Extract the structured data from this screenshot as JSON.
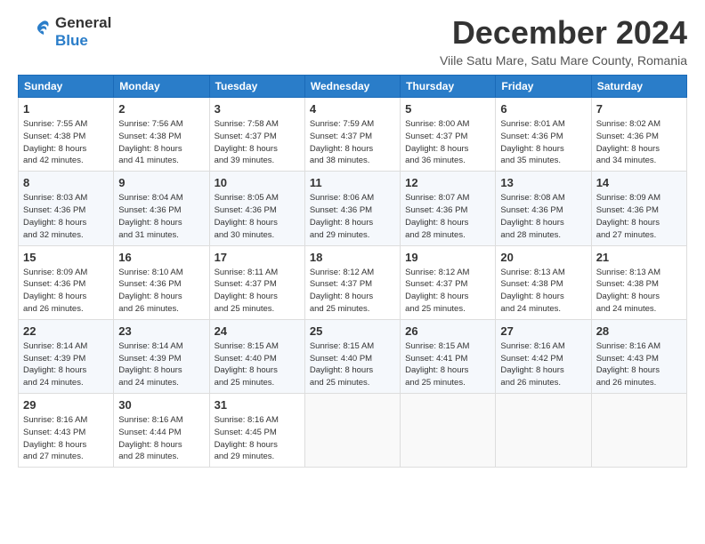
{
  "header": {
    "logo_general": "General",
    "logo_blue": "Blue",
    "month_title": "December 2024",
    "subtitle": "Viile Satu Mare, Satu Mare County, Romania"
  },
  "weekdays": [
    "Sunday",
    "Monday",
    "Tuesday",
    "Wednesday",
    "Thursday",
    "Friday",
    "Saturday"
  ],
  "weeks": [
    [
      {
        "day": "1",
        "info": "Sunrise: 7:55 AM\nSunset: 4:38 PM\nDaylight: 8 hours\nand 42 minutes."
      },
      {
        "day": "2",
        "info": "Sunrise: 7:56 AM\nSunset: 4:38 PM\nDaylight: 8 hours\nand 41 minutes."
      },
      {
        "day": "3",
        "info": "Sunrise: 7:58 AM\nSunset: 4:37 PM\nDaylight: 8 hours\nand 39 minutes."
      },
      {
        "day": "4",
        "info": "Sunrise: 7:59 AM\nSunset: 4:37 PM\nDaylight: 8 hours\nand 38 minutes."
      },
      {
        "day": "5",
        "info": "Sunrise: 8:00 AM\nSunset: 4:37 PM\nDaylight: 8 hours\nand 36 minutes."
      },
      {
        "day": "6",
        "info": "Sunrise: 8:01 AM\nSunset: 4:36 PM\nDaylight: 8 hours\nand 35 minutes."
      },
      {
        "day": "7",
        "info": "Sunrise: 8:02 AM\nSunset: 4:36 PM\nDaylight: 8 hours\nand 34 minutes."
      }
    ],
    [
      {
        "day": "8",
        "info": "Sunrise: 8:03 AM\nSunset: 4:36 PM\nDaylight: 8 hours\nand 32 minutes."
      },
      {
        "day": "9",
        "info": "Sunrise: 8:04 AM\nSunset: 4:36 PM\nDaylight: 8 hours\nand 31 minutes."
      },
      {
        "day": "10",
        "info": "Sunrise: 8:05 AM\nSunset: 4:36 PM\nDaylight: 8 hours\nand 30 minutes."
      },
      {
        "day": "11",
        "info": "Sunrise: 8:06 AM\nSunset: 4:36 PM\nDaylight: 8 hours\nand 29 minutes."
      },
      {
        "day": "12",
        "info": "Sunrise: 8:07 AM\nSunset: 4:36 PM\nDaylight: 8 hours\nand 28 minutes."
      },
      {
        "day": "13",
        "info": "Sunrise: 8:08 AM\nSunset: 4:36 PM\nDaylight: 8 hours\nand 28 minutes."
      },
      {
        "day": "14",
        "info": "Sunrise: 8:09 AM\nSunset: 4:36 PM\nDaylight: 8 hours\nand 27 minutes."
      }
    ],
    [
      {
        "day": "15",
        "info": "Sunrise: 8:09 AM\nSunset: 4:36 PM\nDaylight: 8 hours\nand 26 minutes."
      },
      {
        "day": "16",
        "info": "Sunrise: 8:10 AM\nSunset: 4:36 PM\nDaylight: 8 hours\nand 26 minutes."
      },
      {
        "day": "17",
        "info": "Sunrise: 8:11 AM\nSunset: 4:37 PM\nDaylight: 8 hours\nand 25 minutes."
      },
      {
        "day": "18",
        "info": "Sunrise: 8:12 AM\nSunset: 4:37 PM\nDaylight: 8 hours\nand 25 minutes."
      },
      {
        "day": "19",
        "info": "Sunrise: 8:12 AM\nSunset: 4:37 PM\nDaylight: 8 hours\nand 25 minutes."
      },
      {
        "day": "20",
        "info": "Sunrise: 8:13 AM\nSunset: 4:38 PM\nDaylight: 8 hours\nand 24 minutes."
      },
      {
        "day": "21",
        "info": "Sunrise: 8:13 AM\nSunset: 4:38 PM\nDaylight: 8 hours\nand 24 minutes."
      }
    ],
    [
      {
        "day": "22",
        "info": "Sunrise: 8:14 AM\nSunset: 4:39 PM\nDaylight: 8 hours\nand 24 minutes."
      },
      {
        "day": "23",
        "info": "Sunrise: 8:14 AM\nSunset: 4:39 PM\nDaylight: 8 hours\nand 24 minutes."
      },
      {
        "day": "24",
        "info": "Sunrise: 8:15 AM\nSunset: 4:40 PM\nDaylight: 8 hours\nand 25 minutes."
      },
      {
        "day": "25",
        "info": "Sunrise: 8:15 AM\nSunset: 4:40 PM\nDaylight: 8 hours\nand 25 minutes."
      },
      {
        "day": "26",
        "info": "Sunrise: 8:15 AM\nSunset: 4:41 PM\nDaylight: 8 hours\nand 25 minutes."
      },
      {
        "day": "27",
        "info": "Sunrise: 8:16 AM\nSunset: 4:42 PM\nDaylight: 8 hours\nand 26 minutes."
      },
      {
        "day": "28",
        "info": "Sunrise: 8:16 AM\nSunset: 4:43 PM\nDaylight: 8 hours\nand 26 minutes."
      }
    ],
    [
      {
        "day": "29",
        "info": "Sunrise: 8:16 AM\nSunset: 4:43 PM\nDaylight: 8 hours\nand 27 minutes."
      },
      {
        "day": "30",
        "info": "Sunrise: 8:16 AM\nSunset: 4:44 PM\nDaylight: 8 hours\nand 28 minutes."
      },
      {
        "day": "31",
        "info": "Sunrise: 8:16 AM\nSunset: 4:45 PM\nDaylight: 8 hours\nand 29 minutes."
      },
      {
        "day": "",
        "info": ""
      },
      {
        "day": "",
        "info": ""
      },
      {
        "day": "",
        "info": ""
      },
      {
        "day": "",
        "info": ""
      }
    ]
  ]
}
